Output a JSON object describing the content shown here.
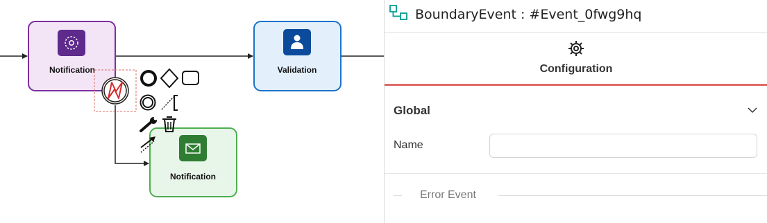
{
  "canvas": {
    "tasks": {
      "notification_1": "Notification",
      "validation": "Validation",
      "notification_2": "Notification"
    }
  },
  "panel": {
    "header_title": "BoundaryEvent : #Event_0fwg9hq",
    "tab_label": "Configuration",
    "section_title": "Global",
    "name_label": "Name",
    "name_value": "",
    "fieldset_legend": "Error Event"
  },
  "colors": {
    "accent_red": "#e06b66",
    "purple_task": "#7b2f9e",
    "blue_task": "#1a73c9",
    "green_task": "#4caf50",
    "header_icon": "#1aa39a"
  }
}
